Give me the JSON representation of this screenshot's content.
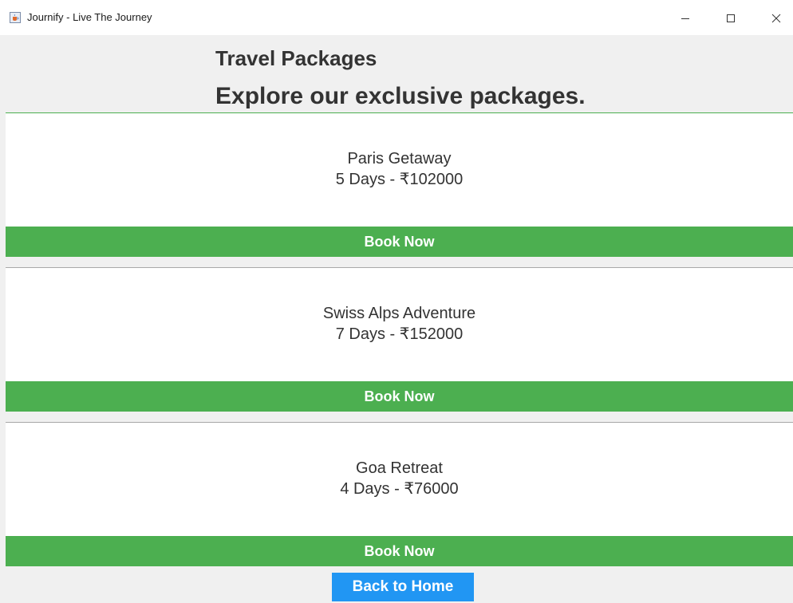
{
  "window": {
    "title": "Journify - Live The Journey",
    "app_icon": "java-coffee-icon",
    "controls": [
      "minimize-icon",
      "maximize-icon",
      "close-icon"
    ]
  },
  "header": {
    "title": "Travel Packages",
    "subtitle": "Explore our exclusive packages."
  },
  "packages": [
    {
      "name": "Paris Getaway",
      "details": "5 Days - ₹102000",
      "button_label": "Book Now"
    },
    {
      "name": "Swiss Alps Adventure",
      "details": "7 Days - ₹152000",
      "button_label": "Book Now"
    },
    {
      "name": "Goa Retreat",
      "details": "4 Days - ₹76000",
      "button_label": "Book Now"
    }
  ],
  "footer": {
    "back_label": "Back to Home"
  },
  "colors": {
    "accent_green": "#4caf50",
    "accent_blue": "#2196f3",
    "text": "#333333"
  }
}
